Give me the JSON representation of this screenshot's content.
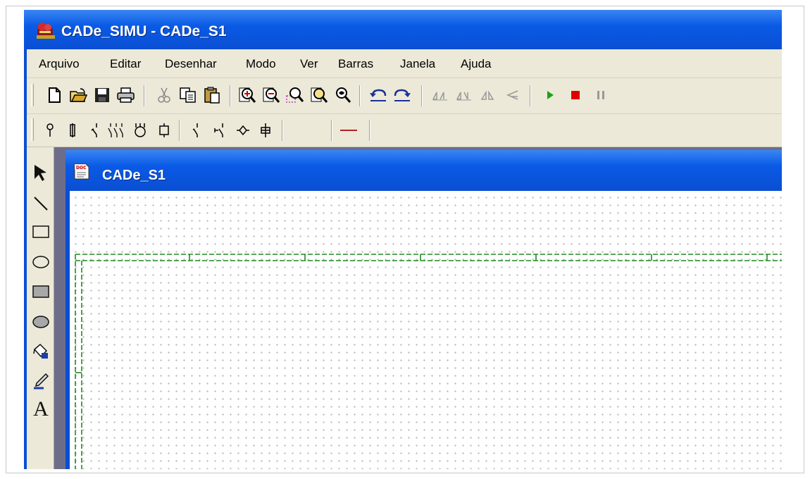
{
  "window": {
    "title": "CADe_SIMU - CADe_S1",
    "icon": "cade-simu-app-icon"
  },
  "menu": [
    {
      "label": "Arquivo"
    },
    {
      "label": "Editar"
    },
    {
      "label": "Desenhar"
    },
    {
      "label": "Modo"
    },
    {
      "label": "Ver"
    },
    {
      "label": "Barras"
    },
    {
      "label": "Janela"
    },
    {
      "label": "Ajuda"
    }
  ],
  "toolbar_main": {
    "file": [
      "new-icon",
      "open-folder-icon",
      "save-icon",
      "print-icon"
    ],
    "edit": [
      "cut-icon",
      "copy-icon",
      "paste-icon"
    ],
    "zoom": [
      "zoom-in-icon",
      "zoom-out-icon",
      "zoom-area-icon",
      "zoom-fit-icon",
      "zoom-pan-icon"
    ],
    "history": [
      "undo-icon",
      "redo-icon"
    ],
    "transform": [
      "mirror-icon",
      "mirror-icon",
      "flip-icon",
      "rotate-icon"
    ],
    "simulation": [
      "play-icon",
      "stop-icon",
      "pause-icon"
    ]
  },
  "toolbar_components": {
    "groups": [
      [
        "supply-terminal-icon",
        "fuse-icon",
        "disconnect-switch-icon",
        "contactor-icon",
        "motor-icon",
        "coil-icon"
      ],
      [
        "pushbutton-icon",
        "timer-contact-icon",
        "sensor-icon",
        "lamp-icon"
      ],
      [
        "empty-slot"
      ],
      [
        "wire-icon"
      ]
    ],
    "wire_color": "#b22222"
  },
  "left_tools": [
    "select-arrow-icon",
    "line-tool-icon",
    "rectangle-tool-icon",
    "ellipse-tool-icon",
    "filled-rectangle-tool-icon",
    "filled-ellipse-tool-icon",
    "fill-color-icon",
    "pen-color-icon",
    "text-tool-icon"
  ],
  "text_tool_glyph": "A",
  "document": {
    "title": "CADe_S1",
    "icon": "document-icon"
  },
  "colors": {
    "titlebar": "#0a4fd3",
    "chrome": "#ece9d8",
    "grid_dots": "#b4b4b4",
    "sheet_frame": "#1f8a1f",
    "play": "#1aa31a",
    "stop": "#e00000"
  }
}
